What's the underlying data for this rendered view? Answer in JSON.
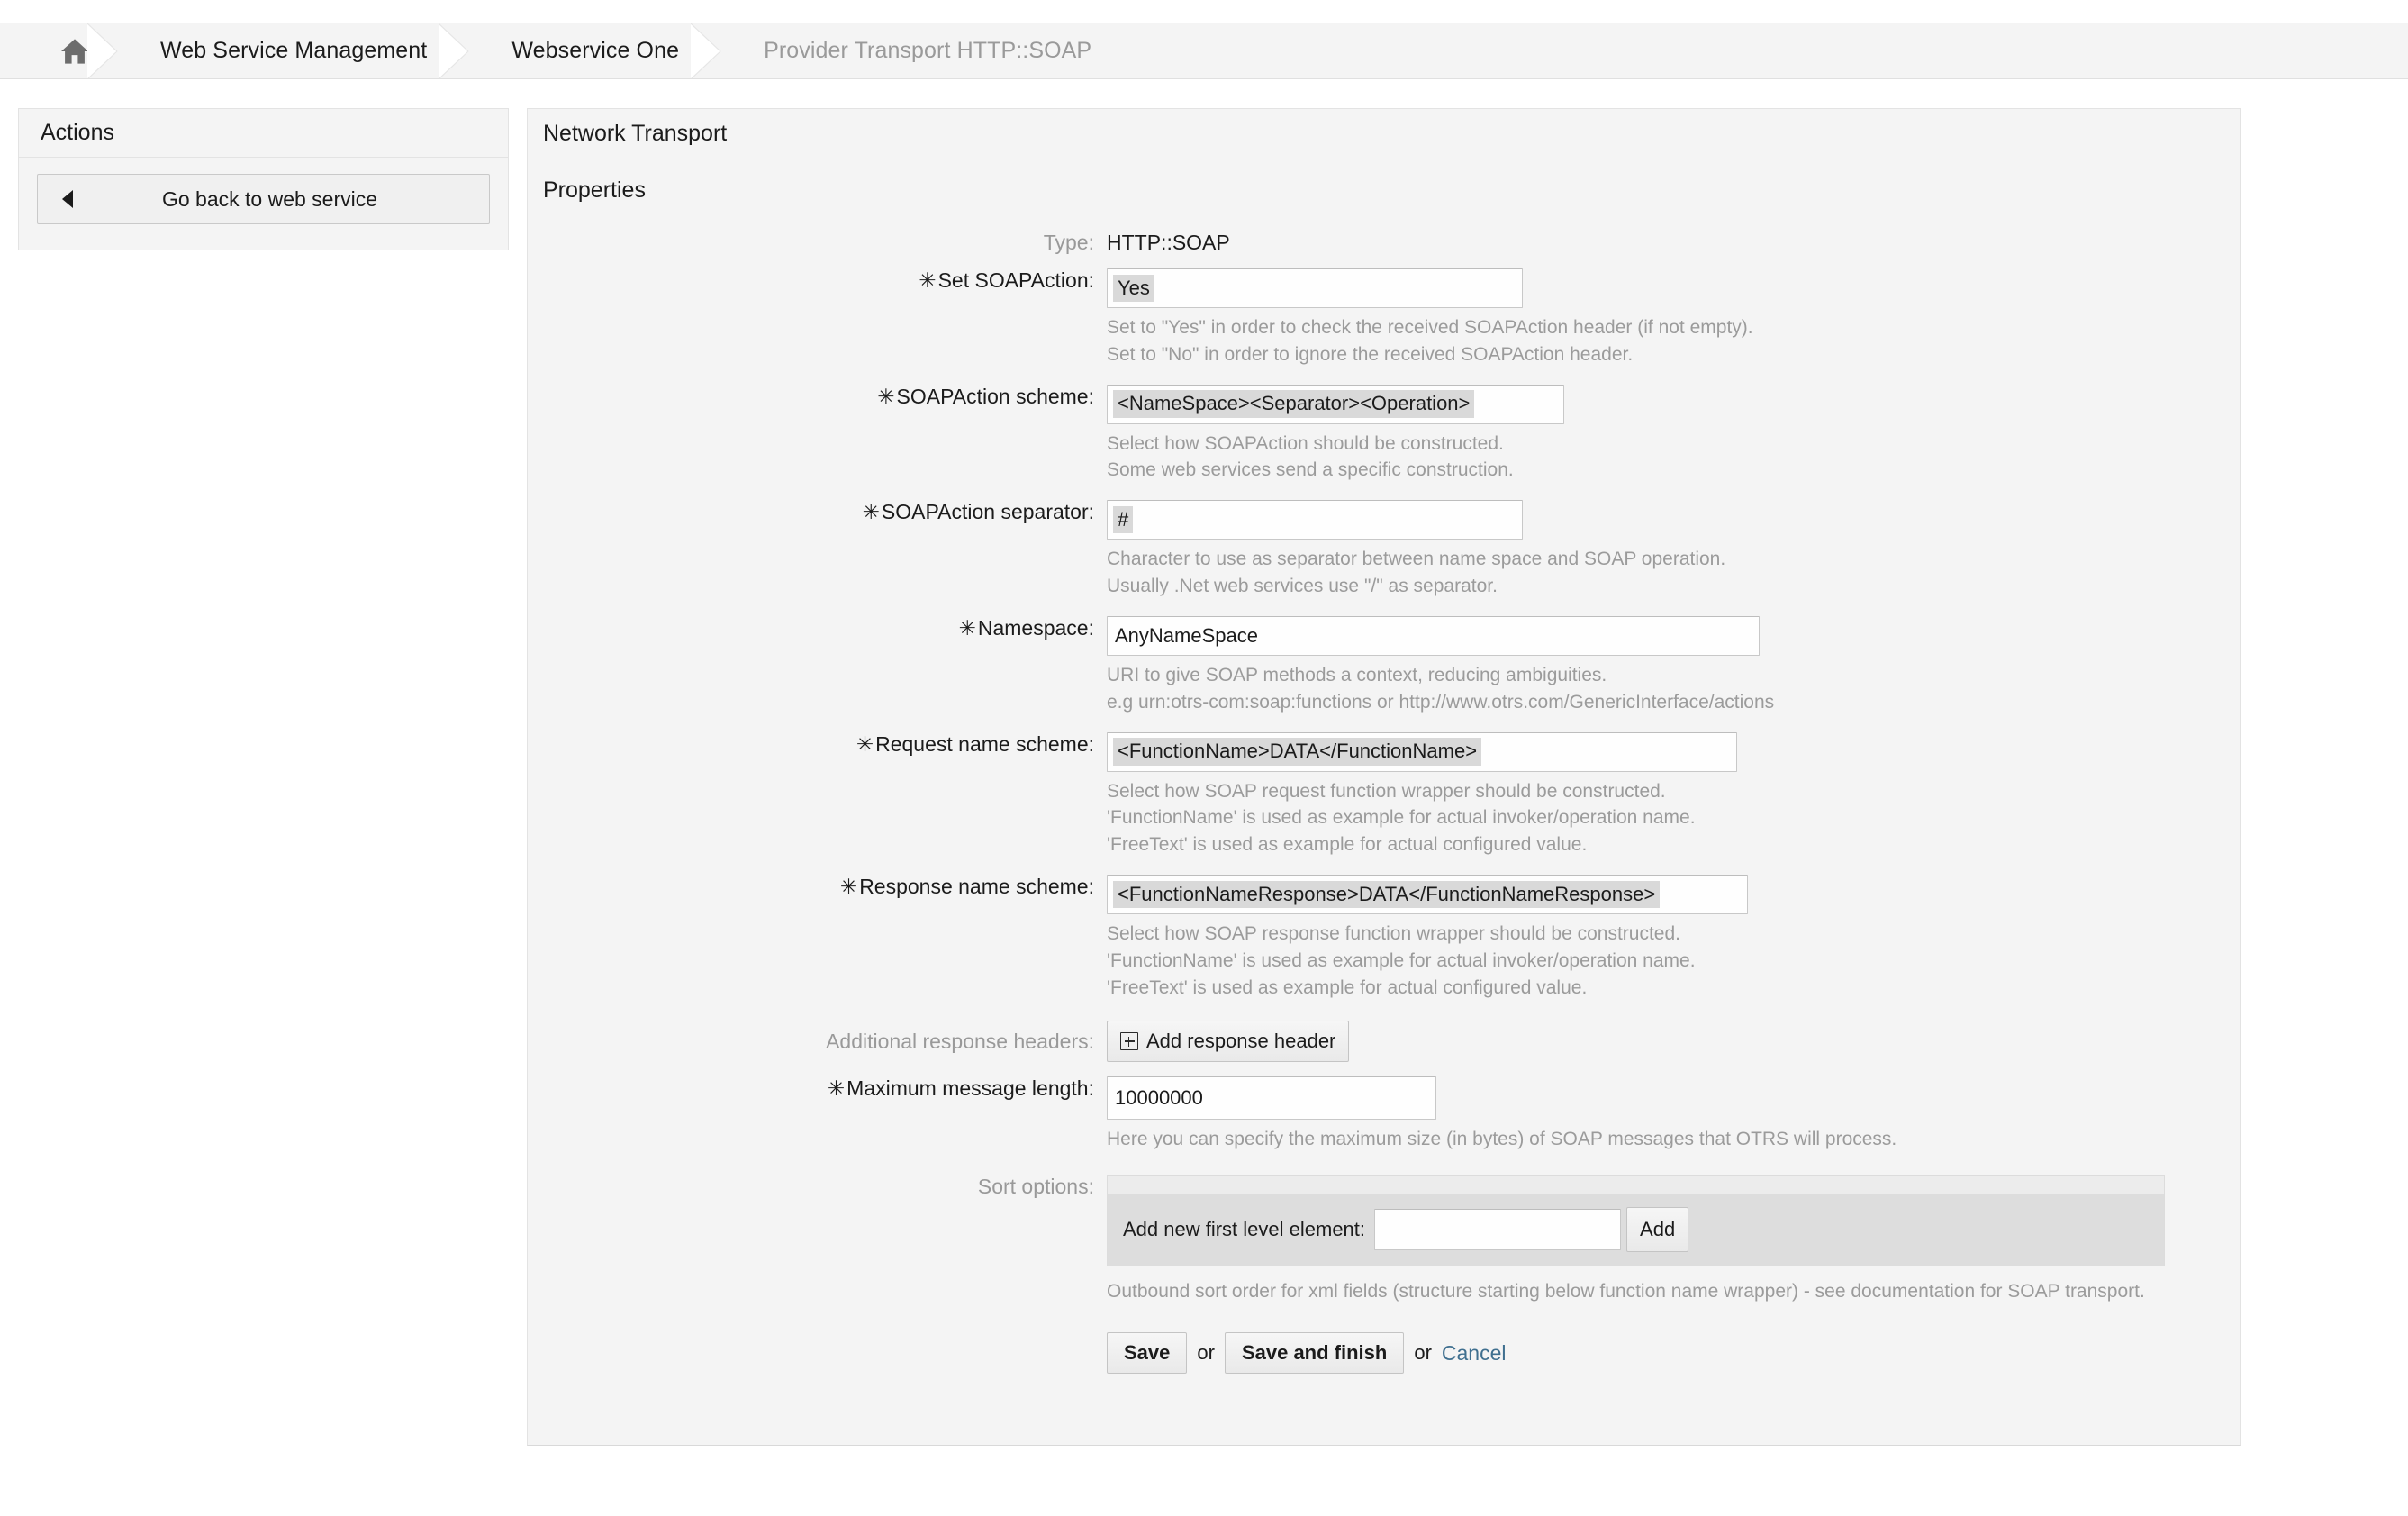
{
  "breadcrumb": {
    "home_icon": "home-icon",
    "items": [
      {
        "label": "Web Service Management"
      },
      {
        "label": "Webservice One"
      },
      {
        "label": "Provider Transport HTTP::SOAP"
      }
    ]
  },
  "sidebar": {
    "title": "Actions",
    "back_button": "Go back to web service"
  },
  "main": {
    "title": "Network Transport",
    "subtitle": "Properties"
  },
  "form": {
    "type": {
      "label": "Type:",
      "value": "HTTP::SOAP"
    },
    "set_soapaction": {
      "label": "Set SOAPAction:",
      "required_mark": "★",
      "value": "Yes",
      "hint_line1": "Set to \"Yes\" in order to check the received SOAPAction header (if not empty).",
      "hint_line2": "Set to \"No\" in order to ignore the received SOAPAction header."
    },
    "soapaction_scheme": {
      "label": "SOAPAction scheme:",
      "value": "<NameSpace><Separator><Operation>",
      "hint_line1": "Select how SOAPAction should be constructed.",
      "hint_line2": "Some web services send a specific construction."
    },
    "soapaction_separator": {
      "label": "SOAPAction separator:",
      "value": "#",
      "hint_line1": "Character to use as separator between name space and SOAP operation.",
      "hint_line2": "Usually .Net web services use \"/\" as separator."
    },
    "namespace": {
      "label": "Namespace:",
      "value": "AnyNameSpace",
      "hint_line1": "URI to give SOAP methods a context, reducing ambiguities.",
      "hint_line2": "e.g urn:otrs-com:soap:functions or http://www.otrs.com/GenericInterface/actions"
    },
    "request_name_scheme": {
      "label": "Request name scheme:",
      "value": "<FunctionName>DATA</FunctionName>",
      "hint_line1": "Select how SOAP request function wrapper should be constructed.",
      "hint_line2": "'FunctionName' is used as example for actual invoker/operation name.",
      "hint_line3": "'FreeText' is used as example for actual configured value."
    },
    "response_name_scheme": {
      "label": "Response name scheme:",
      "value": "<FunctionNameResponse>DATA</FunctionNameResponse>",
      "hint_line1": "Select how SOAP response function wrapper should be constructed.",
      "hint_line2": "'FunctionName' is used as example for actual invoker/operation name.",
      "hint_line3": "'FreeText' is used as example for actual configured value."
    },
    "additional_response_headers": {
      "label": "Additional response headers:",
      "button_label": "Add response header",
      "button_icon": "plus-square-icon"
    },
    "maximum_message_length": {
      "label": "Maximum message length:",
      "value": "10000000",
      "hint_line1": "Here you can specify the maximum size (in bytes) of SOAP messages that OTRS will process."
    },
    "sort_options": {
      "label": "Sort options:",
      "add_element_label": "Add new first level element:",
      "add_element_value": "",
      "add_button_label": "Add",
      "hint_line1": "Outbound sort order for xml fields (structure starting below function name wrapper) - see documentation for SOAP transport."
    },
    "footer": {
      "save_label": "Save",
      "or_1": "or",
      "save_finish_label": "Save and finish",
      "or_2": "or",
      "cancel_label": "Cancel"
    }
  },
  "colors": {
    "panel_bg": "#f4f4f4",
    "hint_text": "#9b9b9b",
    "link": "#3f6f8f",
    "select_highlight": "#d9d9d9",
    "sort_panel": "#dddddd"
  }
}
